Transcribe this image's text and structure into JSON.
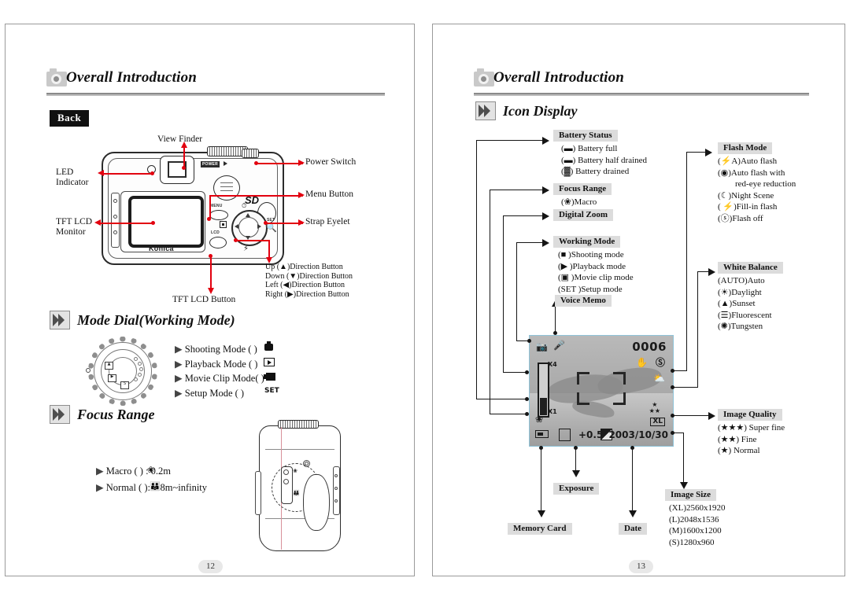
{
  "document": {
    "title": "Overall Introduction",
    "left_page": {
      "header_title": "Overall Introduction",
      "page_number": "12",
      "back_tag": "Back",
      "camera_back_callouts": {
        "view_finder": "View Finder",
        "power_switch": "Power Switch",
        "led_indicator_line1": "LED",
        "led_indicator_line2": "Indicator",
        "menu_button": "Menu Button",
        "tft_lcd_line1": "TFT LCD",
        "tft_lcd_line2": "Monitor",
        "strap_eyelet": "Strap Eyelet",
        "tft_lcd_button": "TFT LCD Button",
        "direction_buttons": [
          "Up (▲)Direction Button",
          "Down (▼)Direction Button",
          "Left (◀)Direction Button",
          "Right (▶)Direction Button"
        ]
      },
      "camera_body_text": {
        "konica": "Konica",
        "power": "POWER",
        "menu": "MENU",
        "lcd": "LCD",
        "set": "SET",
        "sd": "SD"
      },
      "sections": [
        {
          "heading": "Mode Dial(Working Mode)",
          "items": [
            "Shooting Mode (  )",
            "Playback Mode (  )",
            "Movie Clip Mode(  )",
            "Setup Mode (  )"
          ]
        },
        {
          "heading": "Focus Range",
          "items": [
            "Macro (  ) : 0.2m",
            "Normal (  ): 0.8m~infinity"
          ]
        }
      ]
    },
    "right_page": {
      "header_title": "Overall Introduction",
      "section_heading": "Icon Display",
      "page_number": "13",
      "callouts": [
        {
          "id": "battery-status",
          "title": "Battery Status",
          "items": [
            "(▬) Battery full",
            "(▬) Battery half drained",
            "(▓) Battery drained"
          ]
        },
        {
          "id": "focus-range",
          "title": "Focus Range",
          "items": [
            "(❀)Macro"
          ]
        },
        {
          "id": "digital-zoom",
          "title": "Digital Zoom",
          "items": []
        },
        {
          "id": "working-mode",
          "title": "Working Mode",
          "items": [
            "(■ )Shooting mode",
            "(▶ )Playback mode",
            "(▣ )Movie clip mode",
            "(SET )Setup mode"
          ]
        },
        {
          "id": "voice-memo",
          "title": "Voice Memo",
          "items": []
        },
        {
          "id": "flash-mode",
          "title": "Flash Mode",
          "items": [
            "(⚡A)Auto flash",
            "(◉)Auto flash with",
            "red-eye reduction",
            "(☾)Night Scene",
            "( ⚡)Fill-in flash",
            "(ⓢ)Flash off"
          ]
        },
        {
          "id": "white-balance",
          "title": "White Balance",
          "items": [
            "(AUTO)Auto",
            "(☀)Daylight",
            "(▲)Sunset",
            "(☰)Fluorescent",
            "(✺)Tungsten"
          ]
        },
        {
          "id": "image-quality",
          "title": "Image Quality",
          "items": [
            "(★★★) Super  fine",
            "(★★) Fine",
            "(★) Normal"
          ]
        },
        {
          "id": "image-size",
          "title": "Image Size",
          "items": [
            "(XL)2560x1920",
            "(L)2048x1536",
            "(M)1600x1200",
            "(S)1280x960"
          ]
        },
        {
          "id": "memory-card",
          "title": "Memory Card",
          "items": []
        },
        {
          "id": "exposure",
          "title": "Exposure",
          "items": []
        },
        {
          "id": "date",
          "title": "Date",
          "items": []
        }
      ],
      "lcd_display": {
        "frame_counter": "0006",
        "exposure_value": "+0.5",
        "date": "2003/10/30",
        "zoom_top_label": "X4",
        "zoom_bottom_label": "X1",
        "image_size_badge": "XL",
        "icons": [
          "shooting-mode-icon",
          "voice-memo-icon",
          "anti-shake-icon",
          "flash-off-icon",
          "sunset-wb-icon",
          "quality-stars-icon",
          "macro-icon",
          "battery-icon",
          "memory-card-icon",
          "exposure-icon"
        ]
      }
    }
  },
  "colors": {
    "leader_red": "#e2000f",
    "leader_black": "#151515",
    "highlight_grey": "#dcdcdc",
    "page_border": "#9a9a9a"
  }
}
